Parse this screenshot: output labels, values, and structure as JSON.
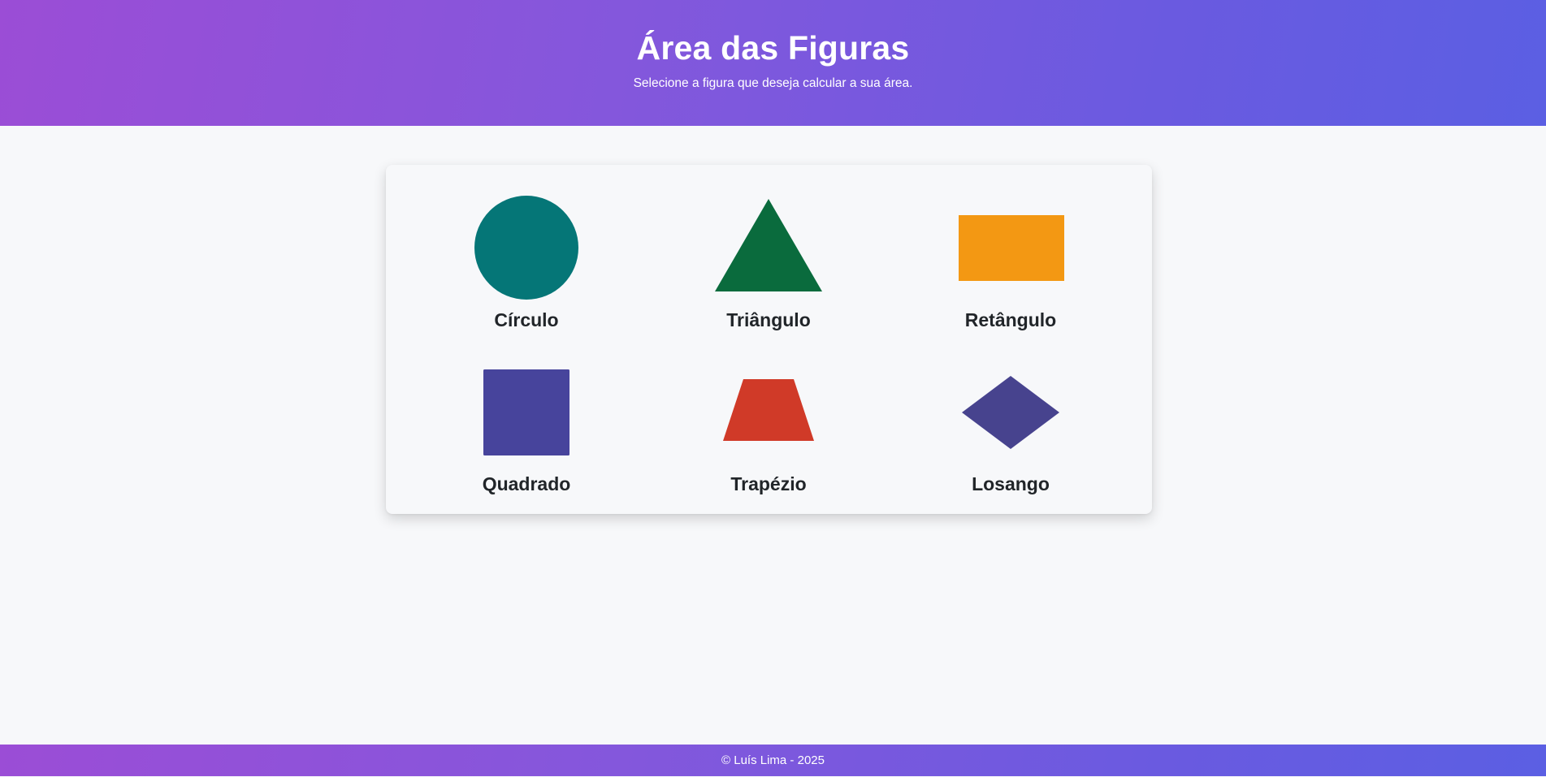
{
  "header": {
    "title": "Área das Figuras",
    "subtitle": "Selecione a figura que deseja calcular a sua área."
  },
  "shapes": [
    {
      "label": "Círculo",
      "icon": "circle-icon",
      "color": "#057677"
    },
    {
      "label": "Triângulo",
      "icon": "triangle-icon",
      "color": "#0a6b3d"
    },
    {
      "label": "Retângulo",
      "icon": "rectangle-icon",
      "color": "#f39813"
    },
    {
      "label": "Quadrado",
      "icon": "square-icon",
      "color": "#47449c"
    },
    {
      "label": "Trapézio",
      "icon": "trapezoid-icon",
      "color": "#d03a28"
    },
    {
      "label": "Losango",
      "icon": "rhombus-icon",
      "color": "#47438e"
    }
  ],
  "footer": {
    "text": "© Luís Lima - 2025"
  },
  "colors": {
    "gradient_start": "#9b4dd6",
    "gradient_end": "#5b5fe3",
    "background": "#f7f8fa",
    "label_text": "#212529"
  }
}
